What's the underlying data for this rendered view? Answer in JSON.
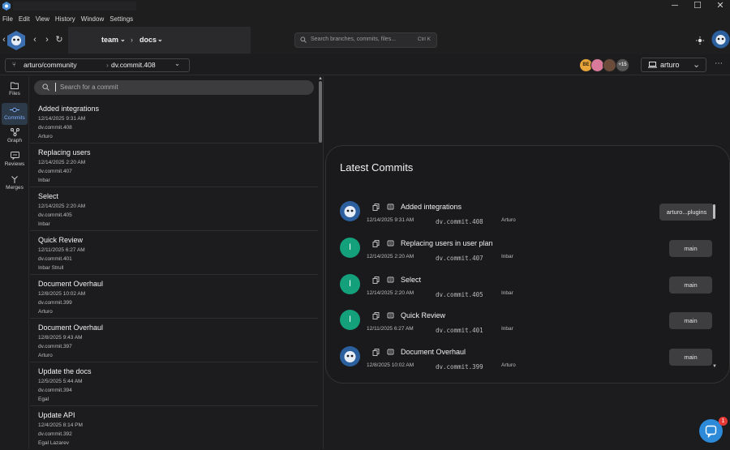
{
  "menu": [
    "File",
    "Edit",
    "View",
    "History",
    "Window",
    "Settings"
  ],
  "window": {
    "minimize": "─",
    "maximize": "☐",
    "close": "✕"
  },
  "breadcrumb": {
    "team": "team",
    "docs": "docs"
  },
  "search": {
    "placeholder": "Search branches, commits, files...",
    "shortcut": "Ctrl K"
  },
  "repo": {
    "name": "arturo/community",
    "commit": "dv.commit.408"
  },
  "collaborators": {
    "initials": "BE",
    "more": "+15"
  },
  "user": {
    "name": "arturo"
  },
  "sidebar": [
    {
      "label": "Files"
    },
    {
      "label": "Commits"
    },
    {
      "label": "Graph"
    },
    {
      "label": "Reviews"
    },
    {
      "label": "Merges"
    }
  ],
  "commit_list": {
    "placeholder": "Search for a commit",
    "items": [
      {
        "title": "Added integrations",
        "date": "12/14/2025 9:31 AM",
        "commit": "dv.commit.408",
        "author": "Arturo"
      },
      {
        "title": "Replacing users",
        "date": "12/14/2025 2:20 AM",
        "commit": "dv.commit.407",
        "author": "Inbar"
      },
      {
        "title": "Select",
        "date": "12/14/2025 2:20 AM",
        "commit": "dv.commit.405",
        "author": "Inbar"
      },
      {
        "title": "Quick Review",
        "date": "12/11/2025 6:27 AM",
        "commit": "dv.commit.401",
        "author": "Inbar Strull"
      },
      {
        "title": "Document Overhaul",
        "date": "12/8/2025 10:02 AM",
        "commit": "dv.commit.399",
        "author": "Arturo"
      },
      {
        "title": "Document Overhaul",
        "date": "12/8/2025 9:43 AM",
        "commit": "dv.commit.397",
        "author": "Arturo"
      },
      {
        "title": "Update the docs",
        "date": "12/5/2025 5:44 AM",
        "commit": "dv.commit.394",
        "author": "Egal"
      },
      {
        "title": "Update API",
        "date": "12/4/2025 8:14 PM",
        "commit": "dv.commit.392",
        "author": "Egal Lazarev"
      }
    ]
  },
  "latest": {
    "title": "Latest Commits",
    "items": [
      {
        "avatar": "mascot",
        "title": "Added integrations",
        "date": "12/14/2025 9:31 AM",
        "commit": "dv.commit.408",
        "author": "Arturo",
        "branch": "arturo...plugins"
      },
      {
        "avatar": "I",
        "title": "Replacing users in user plan",
        "date": "12/14/2025 2:20 AM",
        "commit": "dv.commit.407",
        "author": "Inbar",
        "branch": "main"
      },
      {
        "avatar": "I",
        "title": "Select",
        "date": "12/14/2025 2:20 AM",
        "commit": "dv.commit.405",
        "author": "Inbar",
        "branch": "main"
      },
      {
        "avatar": "I",
        "title": "Quick Review",
        "date": "12/11/2025 6:27 AM",
        "commit": "dv.commit.401",
        "author": "Inbar",
        "branch": "main"
      },
      {
        "avatar": "mascot",
        "title": "Document Overhaul",
        "date": "12/8/2025 10:02 AM",
        "commit": "dv.commit.399",
        "author": "Arturo",
        "branch": "main"
      }
    ]
  },
  "chat": {
    "badge": "1"
  },
  "colors": {
    "accent": "#7fb2ff",
    "avatar_letter": "#13a07a",
    "chat": "#2d8ad8",
    "badge": "#e53935"
  }
}
